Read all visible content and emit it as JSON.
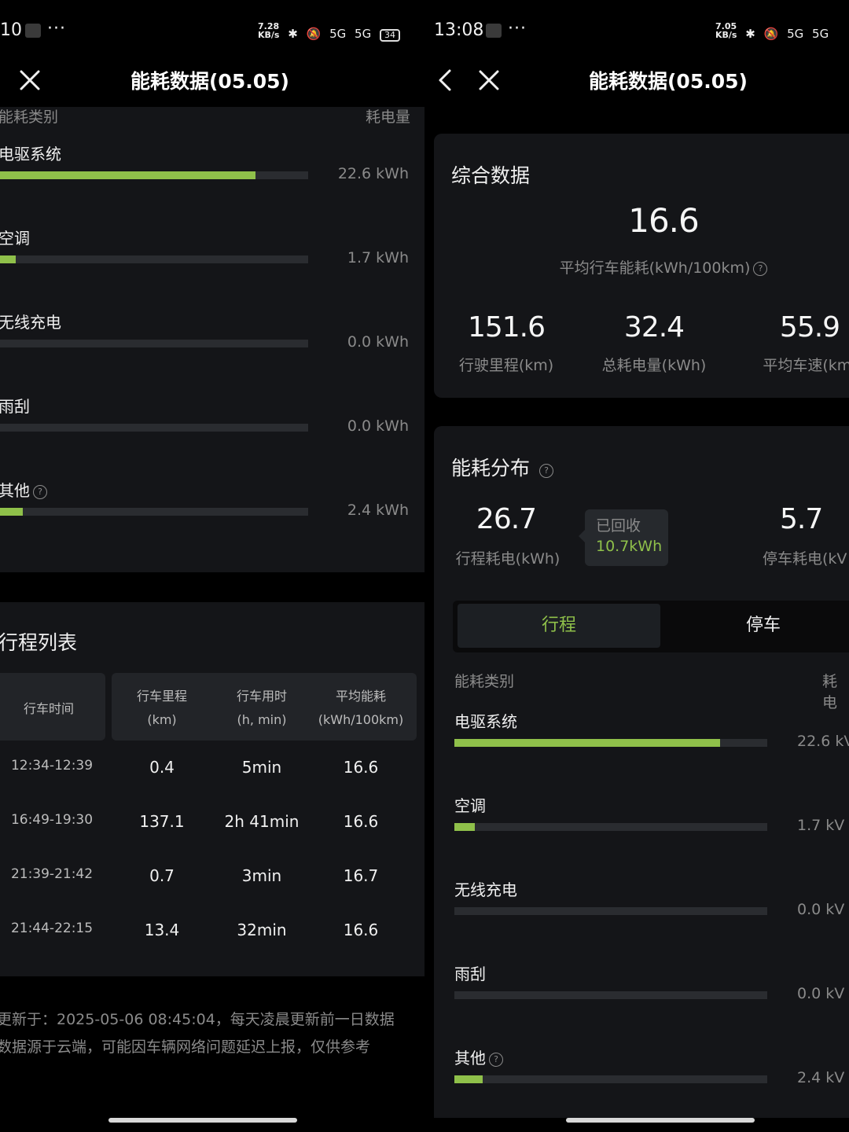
{
  "left": {
    "status": {
      "time": "10",
      "dots": "···",
      "speed": "7.28\nKB/s",
      "net1": "5G",
      "net2": "5G",
      "battery": "34"
    },
    "nav": {
      "title": "能耗数据(05.05)"
    },
    "energy_breakdown": {
      "header_category": "能耗类别",
      "header_value": "耗电量",
      "items": [
        {
          "label": "电驱系统",
          "value": "22.6 kWh",
          "fraction": 0.83
        },
        {
          "label": "空调",
          "value": "1.7 kWh",
          "fraction": 0.05
        },
        {
          "label": "无线充电",
          "value": "0.0 kWh",
          "fraction": 0.0
        },
        {
          "label": "雨刮",
          "value": "0.0 kWh",
          "fraction": 0.0
        },
        {
          "label": "其他",
          "value": "2.4 kWh",
          "fraction": 0.075,
          "help": "?"
        }
      ]
    },
    "trips": {
      "title": "行程列表",
      "columns": [
        {
          "line1": "行车时间",
          "line2": ""
        },
        {
          "line1": "行车里程",
          "line2": "(km)"
        },
        {
          "line1": "行车用时",
          "line2": "(h, min)"
        },
        {
          "line1": "平均能耗",
          "line2": "(kWh/100km)"
        }
      ],
      "rows": [
        [
          "12:34-12:39",
          "0.4",
          "5min",
          "16.6"
        ],
        [
          "16:49-19:30",
          "137.1",
          "2h 41min",
          "16.6"
        ],
        [
          "21:39-21:42",
          "0.7",
          "3min",
          "16.7"
        ],
        [
          "21:44-22:15",
          "13.4",
          "32min",
          "16.6"
        ]
      ]
    },
    "footnote": {
      "line1": "更新于：2025-05-06 08:45:04，每天凌晨更新前一日数据",
      "line2": "数据源于云端，可能因车辆网络问题延迟上报，仅供参考"
    }
  },
  "right": {
    "status": {
      "time": "13:08",
      "dots": "···",
      "speed": "7.05\nKB/s",
      "net1": "5G",
      "net2": "5G"
    },
    "nav": {
      "title": "能耗数据(05.05)"
    },
    "summary": {
      "title": "综合数据",
      "main_value": "16.6",
      "main_label": "平均行车能耗(kWh/100km)",
      "help": "?",
      "stats": [
        {
          "value": "151.6",
          "label": "行驶里程(km)"
        },
        {
          "value": "32.4",
          "label": "总耗电量(kWh)"
        },
        {
          "value": "55.9",
          "label": "平均车速(km/"
        }
      ]
    },
    "distribution": {
      "title": "能耗分布",
      "help": "?",
      "trip_value": "26.7",
      "trip_label": "行程耗电(kWh)",
      "recycled_label": "已回收",
      "recycled_value": "10.7kWh",
      "park_value": "5.7",
      "park_label": "停车耗电(kV",
      "tabs": [
        "行程",
        "停车"
      ],
      "header_category": "能耗类别",
      "header_value": "耗电",
      "items": [
        {
          "label": "电驱系统",
          "value": "22.6 kV",
          "fraction": 0.85
        },
        {
          "label": "空调",
          "value": "1.7 kV",
          "fraction": 0.065
        },
        {
          "label": "无线充电",
          "value": "0.0 kV",
          "fraction": 0.0
        },
        {
          "label": "雨刮",
          "value": "0.0 kV",
          "fraction": 0.0
        },
        {
          "label": "其他",
          "value": "2.4 kV",
          "fraction": 0.09,
          "help": "?"
        }
      ]
    }
  },
  "colors": {
    "accent": "#8fc04a",
    "card": "#141518",
    "track": "#2a2c30",
    "muted": "#8a8a8a"
  }
}
